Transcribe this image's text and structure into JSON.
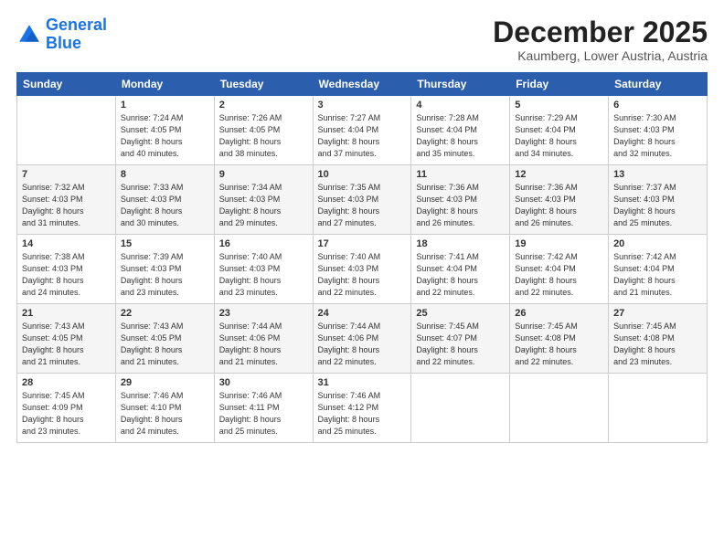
{
  "header": {
    "logo_line1": "General",
    "logo_line2": "Blue",
    "month": "December 2025",
    "location": "Kaumberg, Lower Austria, Austria"
  },
  "weekdays": [
    "Sunday",
    "Monday",
    "Tuesday",
    "Wednesday",
    "Thursday",
    "Friday",
    "Saturday"
  ],
  "weeks": [
    [
      {
        "day": "",
        "info": ""
      },
      {
        "day": "1",
        "info": "Sunrise: 7:24 AM\nSunset: 4:05 PM\nDaylight: 8 hours\nand 40 minutes."
      },
      {
        "day": "2",
        "info": "Sunrise: 7:26 AM\nSunset: 4:05 PM\nDaylight: 8 hours\nand 38 minutes."
      },
      {
        "day": "3",
        "info": "Sunrise: 7:27 AM\nSunset: 4:04 PM\nDaylight: 8 hours\nand 37 minutes."
      },
      {
        "day": "4",
        "info": "Sunrise: 7:28 AM\nSunset: 4:04 PM\nDaylight: 8 hours\nand 35 minutes."
      },
      {
        "day": "5",
        "info": "Sunrise: 7:29 AM\nSunset: 4:04 PM\nDaylight: 8 hours\nand 34 minutes."
      },
      {
        "day": "6",
        "info": "Sunrise: 7:30 AM\nSunset: 4:03 PM\nDaylight: 8 hours\nand 32 minutes."
      }
    ],
    [
      {
        "day": "7",
        "info": "Sunrise: 7:32 AM\nSunset: 4:03 PM\nDaylight: 8 hours\nand 31 minutes."
      },
      {
        "day": "8",
        "info": "Sunrise: 7:33 AM\nSunset: 4:03 PM\nDaylight: 8 hours\nand 30 minutes."
      },
      {
        "day": "9",
        "info": "Sunrise: 7:34 AM\nSunset: 4:03 PM\nDaylight: 8 hours\nand 29 minutes."
      },
      {
        "day": "10",
        "info": "Sunrise: 7:35 AM\nSunset: 4:03 PM\nDaylight: 8 hours\nand 27 minutes."
      },
      {
        "day": "11",
        "info": "Sunrise: 7:36 AM\nSunset: 4:03 PM\nDaylight: 8 hours\nand 26 minutes."
      },
      {
        "day": "12",
        "info": "Sunrise: 7:36 AM\nSunset: 4:03 PM\nDaylight: 8 hours\nand 26 minutes."
      },
      {
        "day": "13",
        "info": "Sunrise: 7:37 AM\nSunset: 4:03 PM\nDaylight: 8 hours\nand 25 minutes."
      }
    ],
    [
      {
        "day": "14",
        "info": "Sunrise: 7:38 AM\nSunset: 4:03 PM\nDaylight: 8 hours\nand 24 minutes."
      },
      {
        "day": "15",
        "info": "Sunrise: 7:39 AM\nSunset: 4:03 PM\nDaylight: 8 hours\nand 23 minutes."
      },
      {
        "day": "16",
        "info": "Sunrise: 7:40 AM\nSunset: 4:03 PM\nDaylight: 8 hours\nand 23 minutes."
      },
      {
        "day": "17",
        "info": "Sunrise: 7:40 AM\nSunset: 4:03 PM\nDaylight: 8 hours\nand 22 minutes."
      },
      {
        "day": "18",
        "info": "Sunrise: 7:41 AM\nSunset: 4:04 PM\nDaylight: 8 hours\nand 22 minutes."
      },
      {
        "day": "19",
        "info": "Sunrise: 7:42 AM\nSunset: 4:04 PM\nDaylight: 8 hours\nand 22 minutes."
      },
      {
        "day": "20",
        "info": "Sunrise: 7:42 AM\nSunset: 4:04 PM\nDaylight: 8 hours\nand 21 minutes."
      }
    ],
    [
      {
        "day": "21",
        "info": "Sunrise: 7:43 AM\nSunset: 4:05 PM\nDaylight: 8 hours\nand 21 minutes."
      },
      {
        "day": "22",
        "info": "Sunrise: 7:43 AM\nSunset: 4:05 PM\nDaylight: 8 hours\nand 21 minutes."
      },
      {
        "day": "23",
        "info": "Sunrise: 7:44 AM\nSunset: 4:06 PM\nDaylight: 8 hours\nand 21 minutes."
      },
      {
        "day": "24",
        "info": "Sunrise: 7:44 AM\nSunset: 4:06 PM\nDaylight: 8 hours\nand 22 minutes."
      },
      {
        "day": "25",
        "info": "Sunrise: 7:45 AM\nSunset: 4:07 PM\nDaylight: 8 hours\nand 22 minutes."
      },
      {
        "day": "26",
        "info": "Sunrise: 7:45 AM\nSunset: 4:08 PM\nDaylight: 8 hours\nand 22 minutes."
      },
      {
        "day": "27",
        "info": "Sunrise: 7:45 AM\nSunset: 4:08 PM\nDaylight: 8 hours\nand 23 minutes."
      }
    ],
    [
      {
        "day": "28",
        "info": "Sunrise: 7:45 AM\nSunset: 4:09 PM\nDaylight: 8 hours\nand 23 minutes."
      },
      {
        "day": "29",
        "info": "Sunrise: 7:46 AM\nSunset: 4:10 PM\nDaylight: 8 hours\nand 24 minutes."
      },
      {
        "day": "30",
        "info": "Sunrise: 7:46 AM\nSunset: 4:11 PM\nDaylight: 8 hours\nand 25 minutes."
      },
      {
        "day": "31",
        "info": "Sunrise: 7:46 AM\nSunset: 4:12 PM\nDaylight: 8 hours\nand 25 minutes."
      },
      {
        "day": "",
        "info": ""
      },
      {
        "day": "",
        "info": ""
      },
      {
        "day": "",
        "info": ""
      }
    ]
  ]
}
